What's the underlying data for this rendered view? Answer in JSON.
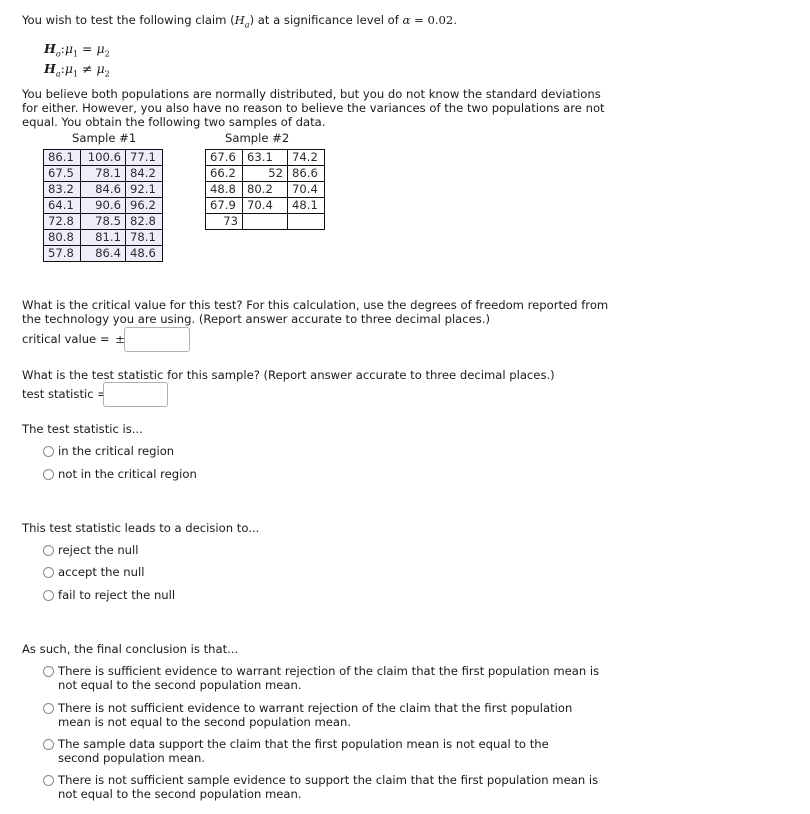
{
  "intro": {
    "prefix": "You wish to test the following claim (",
    "claim_symbol": "H",
    "claim_sub": "a",
    "middle": ") at a significance level of ",
    "alpha_symbol": "α",
    "equals": " = ",
    "alpha_value": "0.02",
    "period": "."
  },
  "hypotheses": {
    "null": {
      "h": "H",
      "sub": "o",
      "colon": ":",
      "mu1": "μ",
      "mu1_sub": "1",
      "op": " = ",
      "mu2": "μ",
      "mu2_sub": "2"
    },
    "alt": {
      "h": "H",
      "sub": "a",
      "colon": ":",
      "mu1": "μ",
      "mu1_sub": "1",
      "op": " ≠ ",
      "mu2": "μ",
      "mu2_sub": "2"
    }
  },
  "description": "You believe both populations are normally distributed, but you do not know the standard deviations for either. However, you also have no reason to believe the variances of the two populations are not equal. You obtain the following two samples of data.",
  "samples": {
    "sample1": {
      "label": "Sample #1",
      "rows": [
        [
          "86.1",
          "100.6",
          "77.1"
        ],
        [
          "67.5",
          "78.1",
          "84.2"
        ],
        [
          "83.2",
          "84.6",
          "92.1"
        ],
        [
          "64.1",
          "90.6",
          "96.2"
        ],
        [
          "72.8",
          "78.5",
          "82.8"
        ],
        [
          "80.8",
          "81.1",
          "78.1"
        ],
        [
          "57.8",
          "86.4",
          "48.6"
        ]
      ]
    },
    "sample2": {
      "label": "Sample #2",
      "rows": [
        [
          "67.6",
          "63.1",
          "74.2"
        ],
        [
          "66.2",
          "52",
          "86.6"
        ],
        [
          "48.8",
          "80.2",
          "70.4"
        ],
        [
          "67.9",
          "70.4",
          "48.1"
        ],
        [
          "73",
          "",
          ""
        ]
      ]
    }
  },
  "critical_value": {
    "question": "What is the critical value for this test? For this calculation, use the degrees of freedom reported from the technology you are using. (Report answer accurate to three decimal places.)",
    "label": "critical value = ",
    "pm": "±",
    "value": ""
  },
  "test_statistic": {
    "question": "What is the test statistic for this sample? (Report answer accurate to three decimal places.)",
    "label": "test statistic = ",
    "value": ""
  },
  "region": {
    "question": "The test statistic is...",
    "options": [
      "in the critical region",
      "not in the critical region"
    ]
  },
  "decision": {
    "question": "This test statistic leads to a decision to...",
    "options": [
      "reject the null",
      "accept the null",
      "fail to reject the null"
    ]
  },
  "conclusion": {
    "question": "As such, the final conclusion is that...",
    "options": [
      "There is sufficient evidence to warrant rejection of the claim that the first population mean is not equal to the second population mean.",
      "There is not sufficient evidence to warrant rejection of the claim that the first population mean is not equal to the second population mean.",
      "The sample data support the claim that the first population mean is not equal to the second population mean.",
      "There is not sufficient sample evidence to support the claim that the first population mean is not equal to the second population mean."
    ]
  }
}
